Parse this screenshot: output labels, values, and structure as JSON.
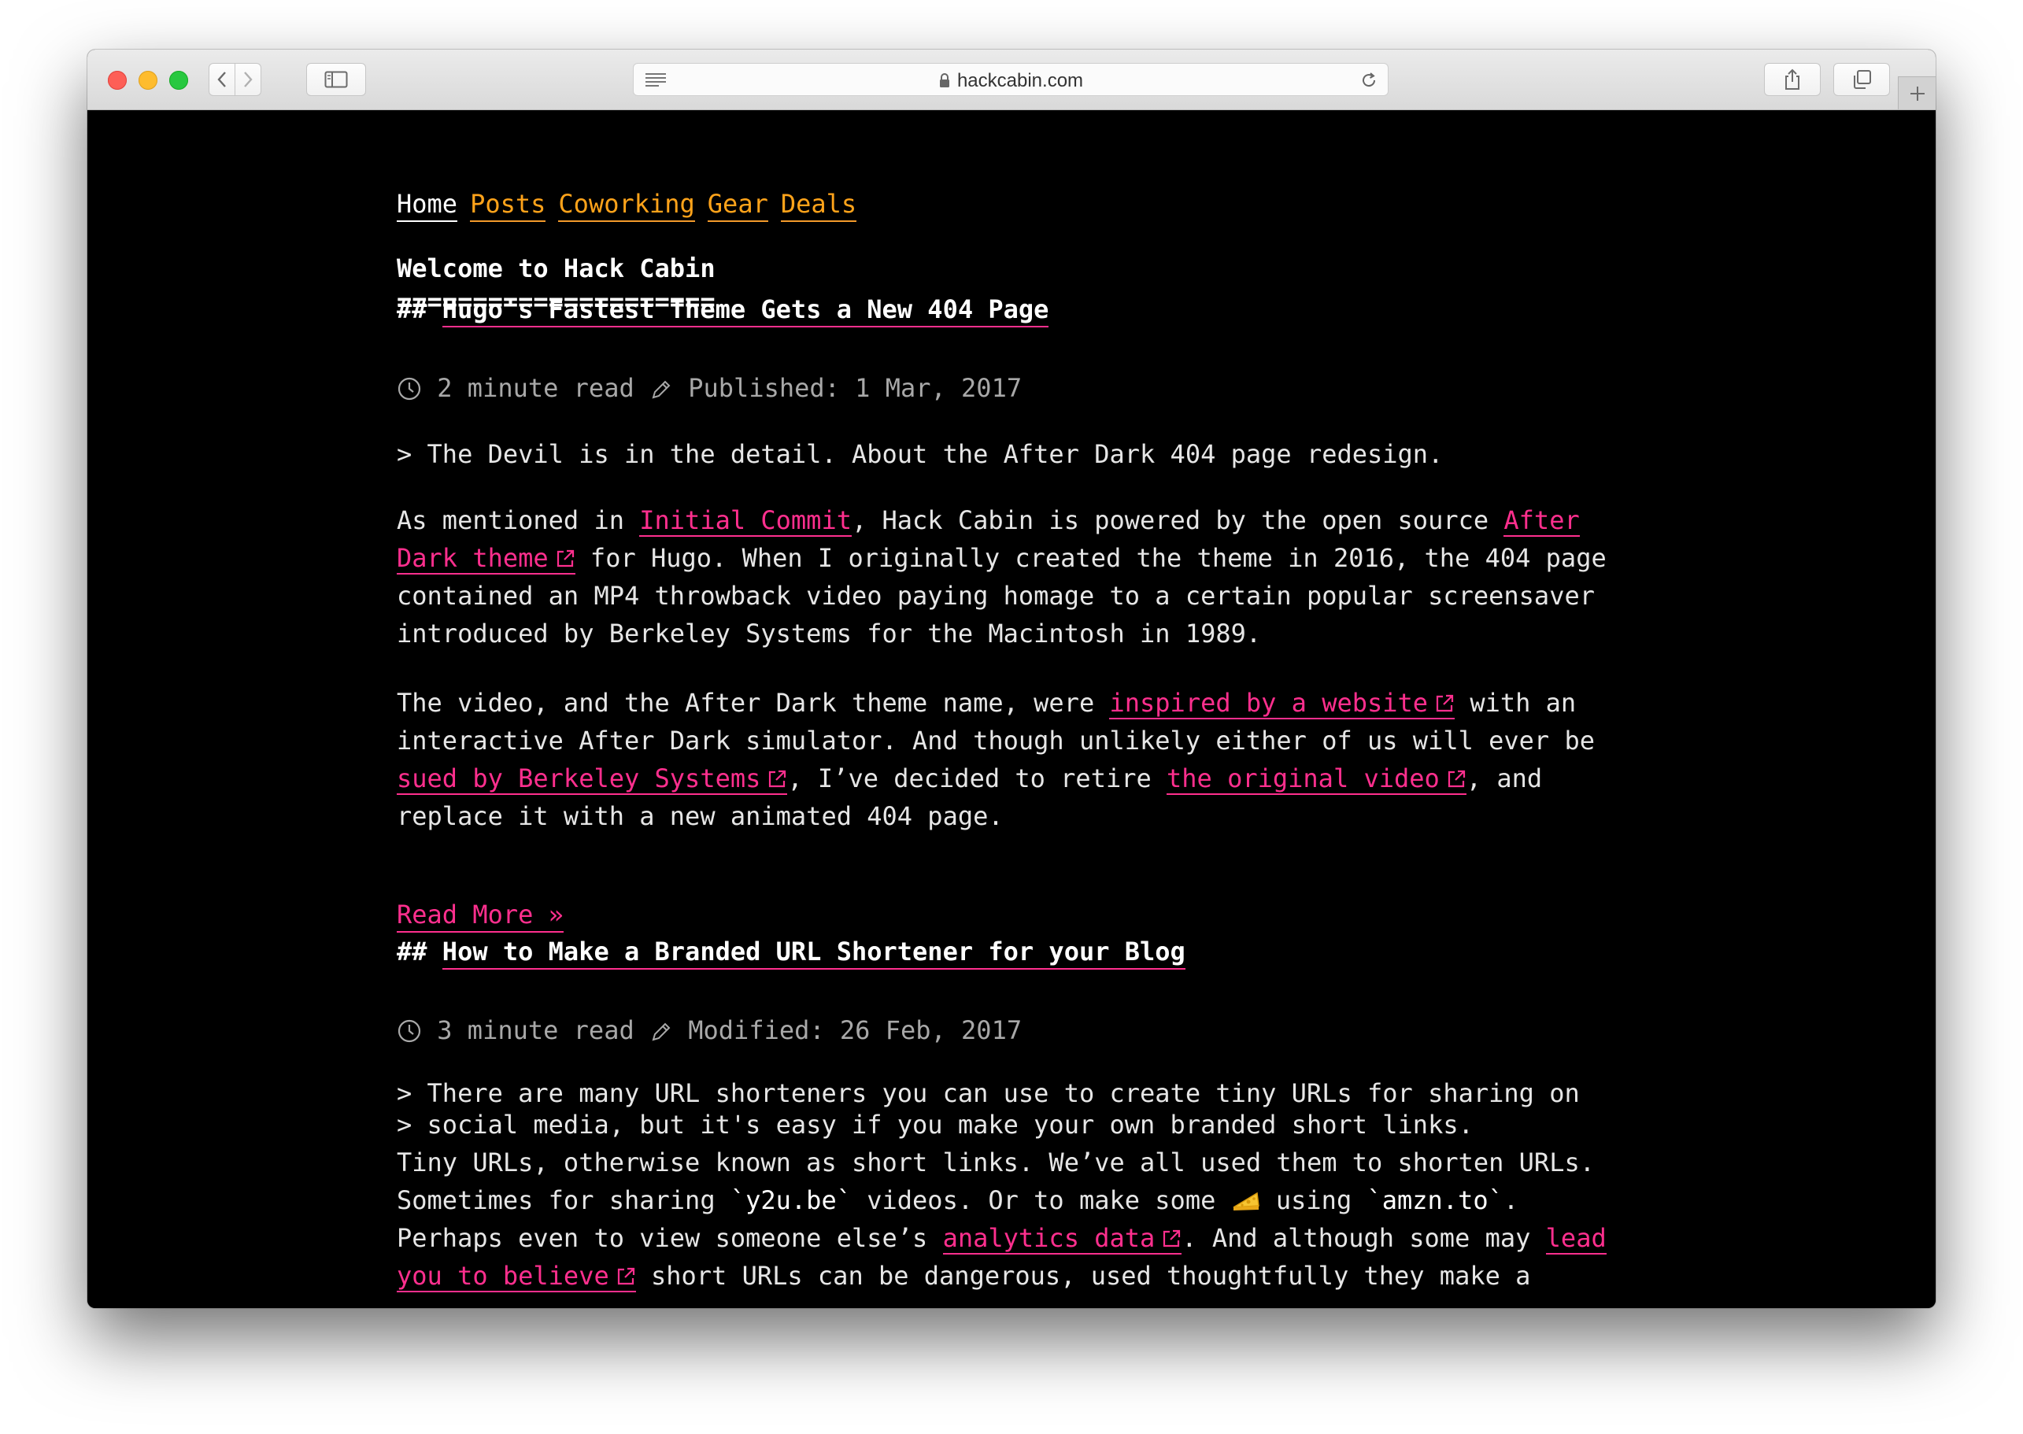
{
  "browser": {
    "url": "hackcabin.com"
  },
  "nav": {
    "items": [
      "Home",
      "Posts",
      "Coworking",
      "Gear",
      "Deals"
    ]
  },
  "welcome": {
    "title": "Welcome to Hack Cabin",
    "underline": "====================="
  },
  "posts": [
    {
      "hash": "##",
      "title": "Hugo's Fastest Theme Gets a New 404 Page",
      "read_time": "2 minute read",
      "date_label": "Published: 1 Mar, 2017",
      "summary": "> The Devil is in the detail. About the After Dark 404 page redesign.",
      "p1_a": "As mentioned in ",
      "p1_link1": "Initial Commit",
      "p1_b": ", Hack Cabin is powered by the open source ",
      "p1_link2": "After Dark theme",
      "p1_c": " for Hugo. When I originally created the theme in 2016, the 404 page contained an MP4 throwback video paying homage to a certain popular screensaver introduced by Berkeley Systems for the Macintosh in 1989.",
      "p2_a": "The video, and the After Dark theme name, were ",
      "p2_link1": "inspired by a website",
      "p2_b": " with an interactive After Dark simulator. And though unlikely either of us will ever be ",
      "p2_link2": "sued by Berkeley Systems",
      "p2_c": ", I’ve decided to retire ",
      "p2_link3": "the original video",
      "p2_d": ", and replace it with a new animated 404 page.",
      "read_more": "Read More »"
    },
    {
      "hash": "##",
      "title": "How to Make a Branded URL Shortener for your Blog",
      "read_time": "3 minute read",
      "date_label": "Modified: 26 Feb, 2017",
      "summary_line1": "> There are many URL shorteners you can use to create tiny URLs for sharing on",
      "summary_line2": "> social media, but it's easy if you make your own branded short links.",
      "p1_a": "Tiny URLs, otherwise known as short links. We’ve all used them to shorten URLs. Sometimes for sharing ",
      "p1_code1": "`y2u.be`",
      "p1_b": " videos. Or to make some ",
      "p1_c": " using ",
      "p1_code2": "`amzn.to`",
      "p1_d": ". Perhaps even to view someone else’s ",
      "p1_link1": "analytics data",
      "p1_e": ". And although some may ",
      "p1_link2": "lead you to believe",
      "p1_f": " short URLs can be dangerous, used thoughtfully they make a"
    }
  ],
  "colors": {
    "nav_link": "#ffa31a",
    "accent_link": "#ff2f8e",
    "meta": "#a8a8a8",
    "background": "#000000"
  }
}
